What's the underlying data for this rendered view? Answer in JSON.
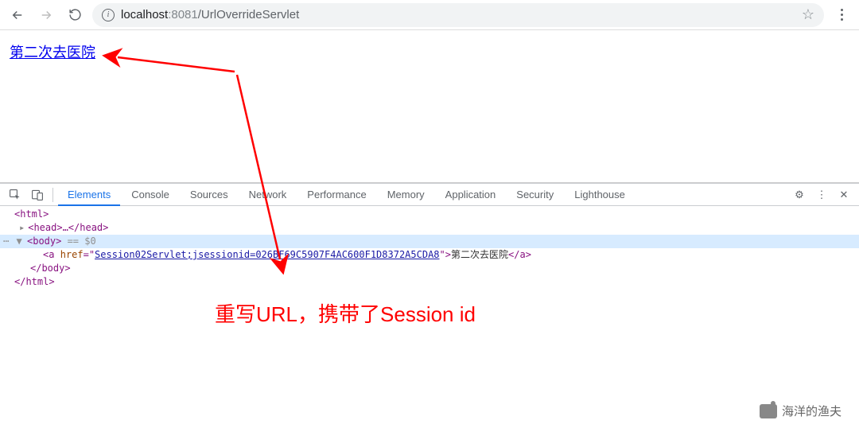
{
  "browser": {
    "url_host": "localhost",
    "url_port": ":8081",
    "url_path": "/UrlOverrideServlet"
  },
  "page": {
    "link_text": "第二次去医院"
  },
  "devtools": {
    "tabs": {
      "elements": "Elements",
      "console": "Console",
      "sources": "Sources",
      "network": "Network",
      "performance": "Performance",
      "memory": "Memory",
      "application": "Application",
      "security": "Security",
      "lighthouse": "Lighthouse"
    },
    "dom": {
      "html_open": "<html>",
      "head": "<head>…</head>",
      "body_open": "<body>",
      "eq_dollar0": " == $0",
      "a_open1": "<a ",
      "a_attr": "href",
      "a_eq": "=\"",
      "a_href": "Session02Servlet;jsessionid=026BF69C5907F4AC600F1D8372A5CDA8",
      "a_close_q": "\"",
      "a_close1": ">",
      "a_text": "第二次去医院",
      "a_close": "</a>",
      "body_close": "</body>",
      "html_close": "</html>"
    }
  },
  "annotation": {
    "text": "重写URL，携带了Session id"
  },
  "watermark": "海洋的渔夫"
}
